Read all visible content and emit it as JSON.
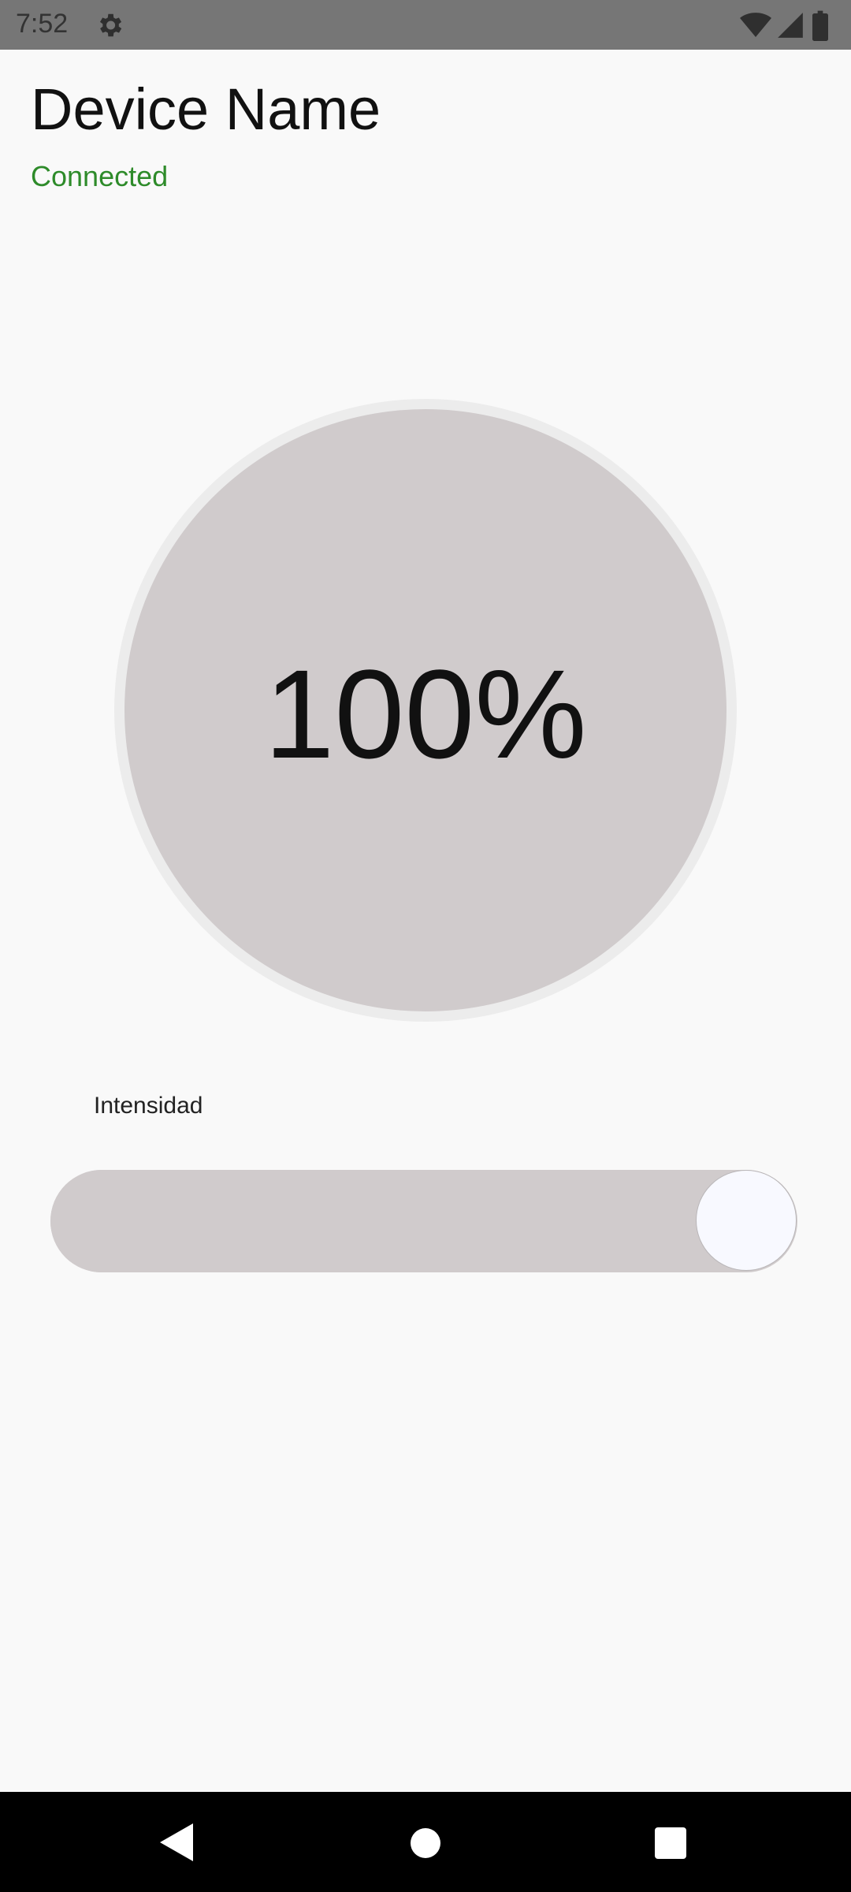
{
  "status_bar": {
    "time": "7:52",
    "icons": [
      "settings-gear-icon",
      "wifi-icon",
      "signal-icon",
      "battery-icon"
    ]
  },
  "header": {
    "device_name": "Device Name",
    "connection_status": "Connected",
    "status_color": "#2e8b2a"
  },
  "dial": {
    "value_text": "100%",
    "fill_color": "#d0cbcc"
  },
  "slider": {
    "label": "Intensidad",
    "value_fraction": 1.0
  },
  "nav_bar": {
    "icons": [
      "back-icon",
      "home-icon",
      "recents-icon"
    ]
  }
}
